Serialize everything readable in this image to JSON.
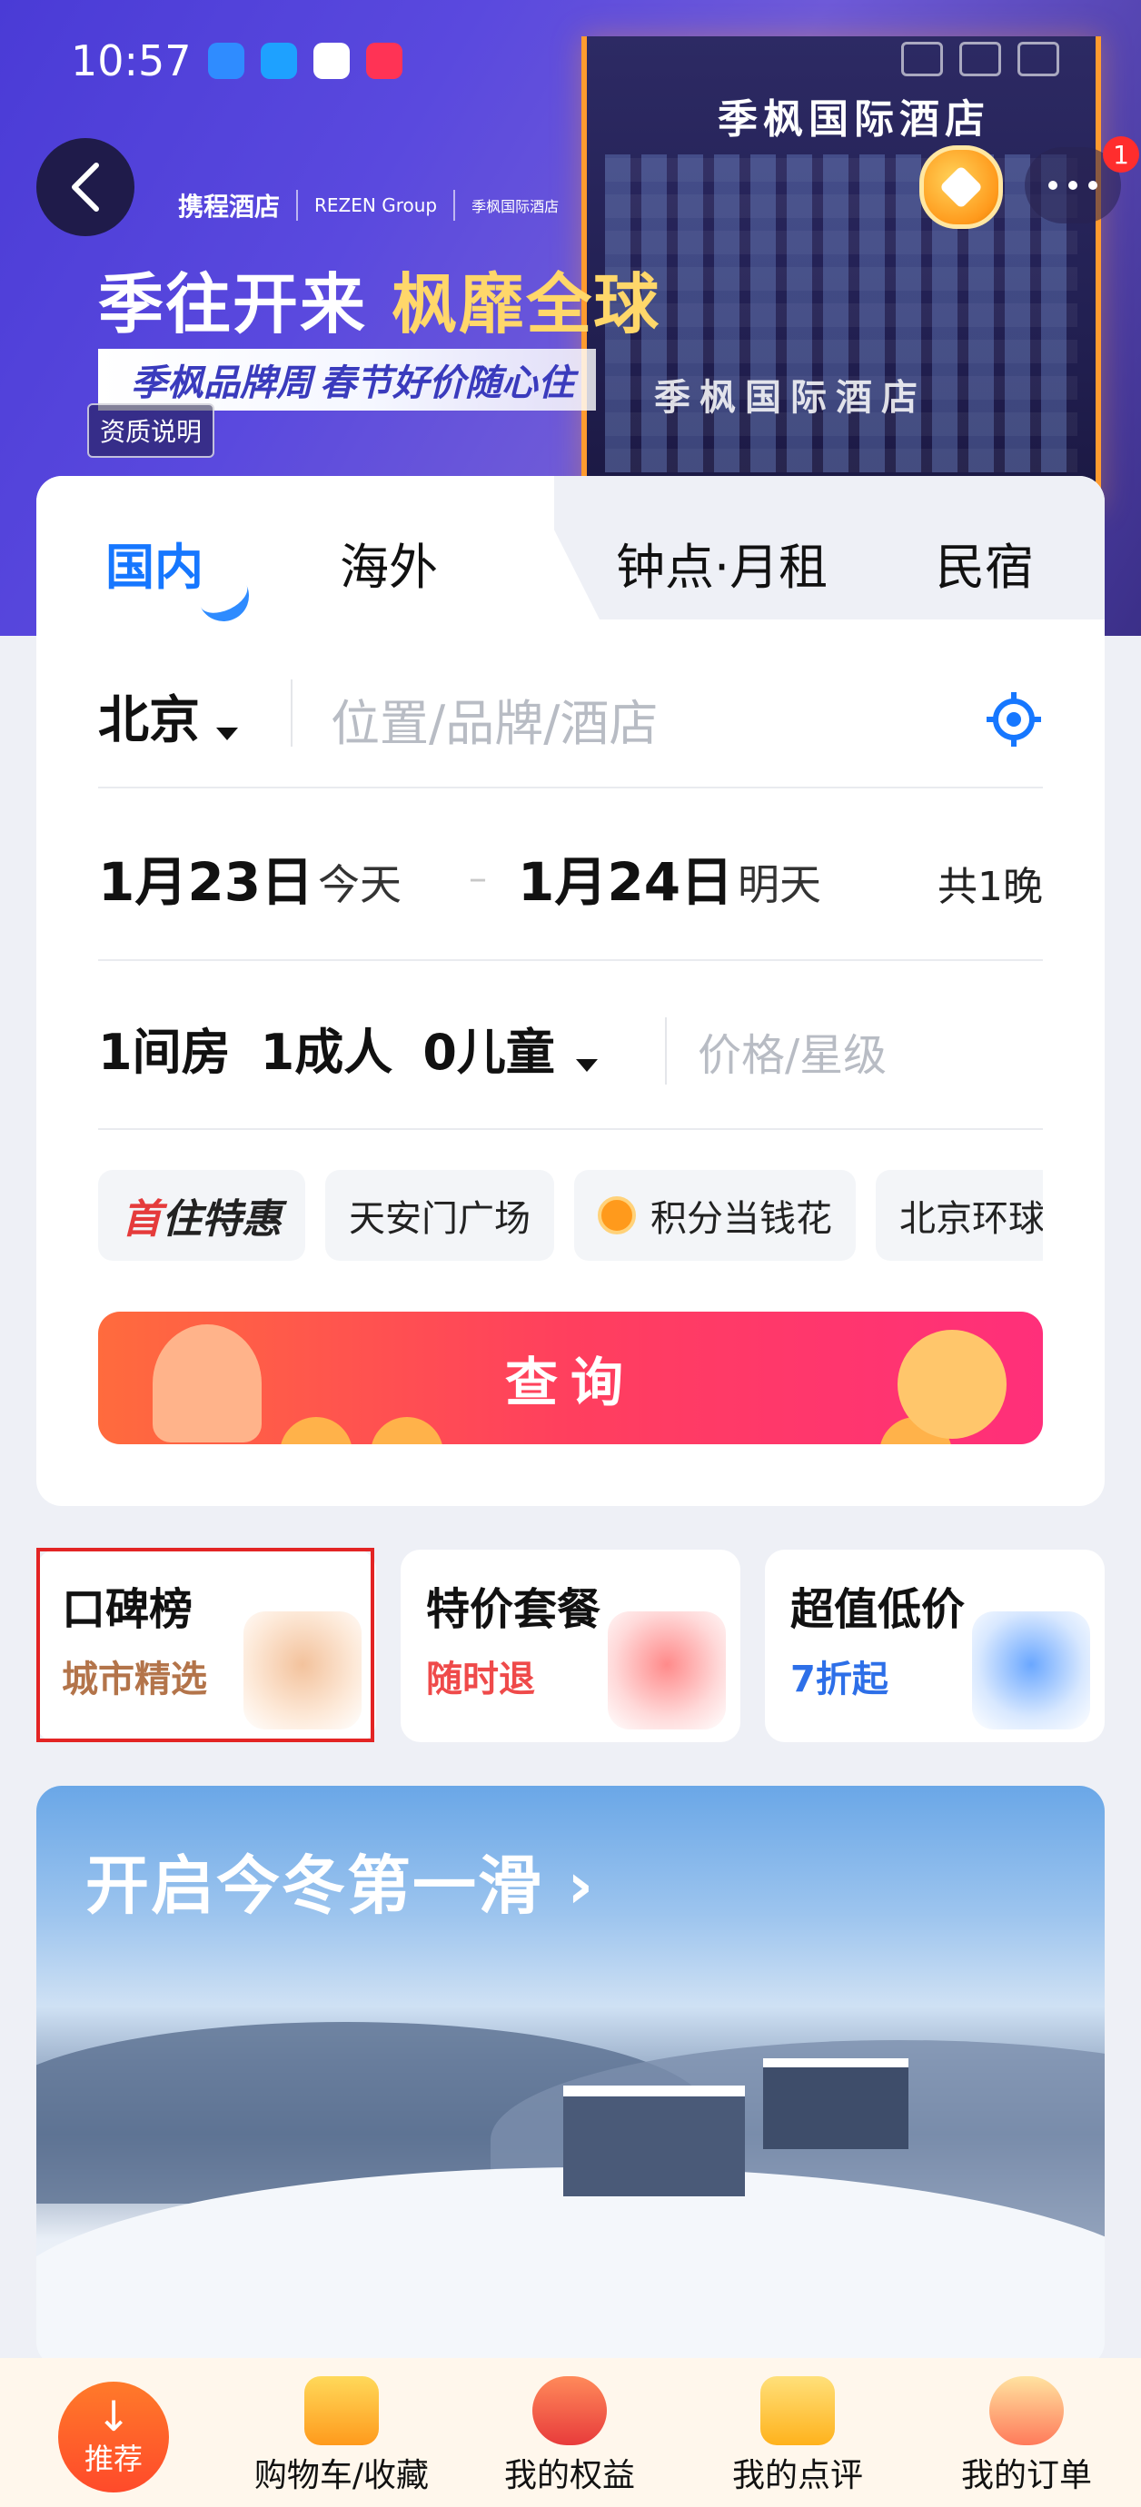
{
  "status_bar": {
    "time": "10:57"
  },
  "banner": {
    "brand_ctrip": "携程酒店",
    "brand_rezen": "REZEN Group",
    "brand_jf": "季枫国际酒店",
    "hotel_sign": "季枫国际酒店",
    "hotel_sign_bottom": "季枫国际酒店",
    "slogan_a": "季往开来 ",
    "slogan_b": "枫靡全球",
    "sub_a": "季枫品牌周",
    "sub_b": "春节好价随心住",
    "qualification": "资质说明",
    "notification_count": "1"
  },
  "tabs": [
    "国内",
    "海外",
    "钟点·月租",
    "民宿"
  ],
  "search": {
    "city": "北京",
    "keyword_placeholder": "位置/品牌/酒店",
    "checkin_date": "1月23日",
    "checkin_label": "今天",
    "checkout_date": "1月24日",
    "checkout_label": "明天",
    "nights": "共1晚",
    "rooms": "1间房",
    "adults": "1成人",
    "children": "0儿童",
    "price_placeholder": "价格/星级",
    "button": "查询"
  },
  "chips": {
    "first_a": "首",
    "first_b": "住特惠",
    "items": [
      "天安门广场",
      "积分当钱花",
      "北京环球"
    ]
  },
  "features": [
    {
      "title": "口碑榜",
      "subtitle": "城市精选",
      "color": "#b3744a"
    },
    {
      "title": "特价套餐",
      "subtitle": "随时退",
      "color": "#ef4a4a"
    },
    {
      "title": "超值低价",
      "subtitle": "7折起",
      "color": "#2d6fe8"
    }
  ],
  "promo": {
    "title": "开启今冬第一滑 ›"
  },
  "bottom_nav": {
    "recommend": "推荐",
    "items": [
      "购物车/收藏",
      "我的权益",
      "我的点评",
      "我的订单"
    ]
  },
  "colors": {
    "accent": "#1677ff",
    "search_btn": "#ff3f5e"
  }
}
